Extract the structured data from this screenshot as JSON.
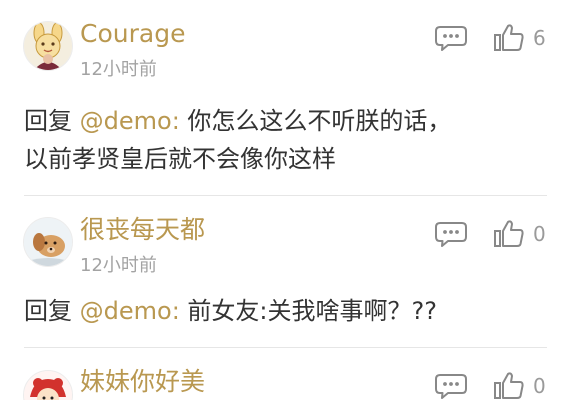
{
  "comments": [
    {
      "username": "Courage",
      "time": "12小时前",
      "likes": "6",
      "reply_prefix": "回复",
      "mention": "@demo:",
      "text_line1": " 你怎么这么不听朕的话，",
      "text_line2": "以前孝贤皇后就不会像你这样"
    },
    {
      "username": "很丧每天都",
      "time": "12小时前",
      "likes": "0",
      "reply_prefix": "回复",
      "mention": "@demo:",
      "text_line1": " 前女友:关我啥事啊？??"
    },
    {
      "username": "妹妹你好美",
      "likes": "0"
    }
  ],
  "icons": {
    "reply": "comment-bubble-icon",
    "like": "thumbs-up-icon"
  },
  "colors": {
    "username": "#b99850",
    "mention": "#b99850",
    "body_text": "#333333",
    "meta_text": "#a3a3a3"
  }
}
